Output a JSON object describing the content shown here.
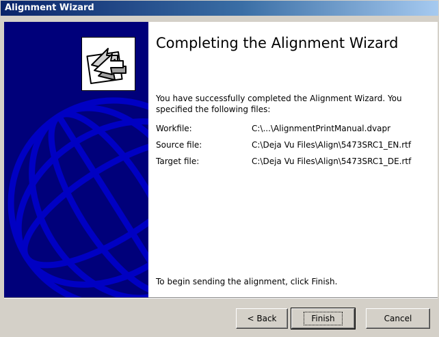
{
  "window": {
    "title": "Alignment Wizard"
  },
  "heading": "Completing the Alignment Wizard",
  "intro": "You have successfully completed the Alignment Wizard. You specified the following files:",
  "files": [
    {
      "label": "Workfile:",
      "value": "C:\\...\\AlignmentPrintManual.dvapr"
    },
    {
      "label": "Source file:",
      "value": "C:\\Deja Vu Files\\Align\\5473SRC1_EN.rtf"
    },
    {
      "label": "Target file:",
      "value": "C:\\Deja Vu Files\\Align\\5473SRC1_DE.rtf"
    }
  ],
  "footer_text": "To begin sending the alignment, click Finish.",
  "buttons": {
    "back": "< Back",
    "finish": "Finish",
    "cancel": "Cancel"
  },
  "icons": {
    "sidebar_graphic": "globe-icon",
    "logo": "align-arrows-icon"
  },
  "colors": {
    "sidebar": "#00007a",
    "titlebar_start": "#0a246a",
    "titlebar_end": "#a6caf0",
    "dialog": "#d4d0c8"
  }
}
